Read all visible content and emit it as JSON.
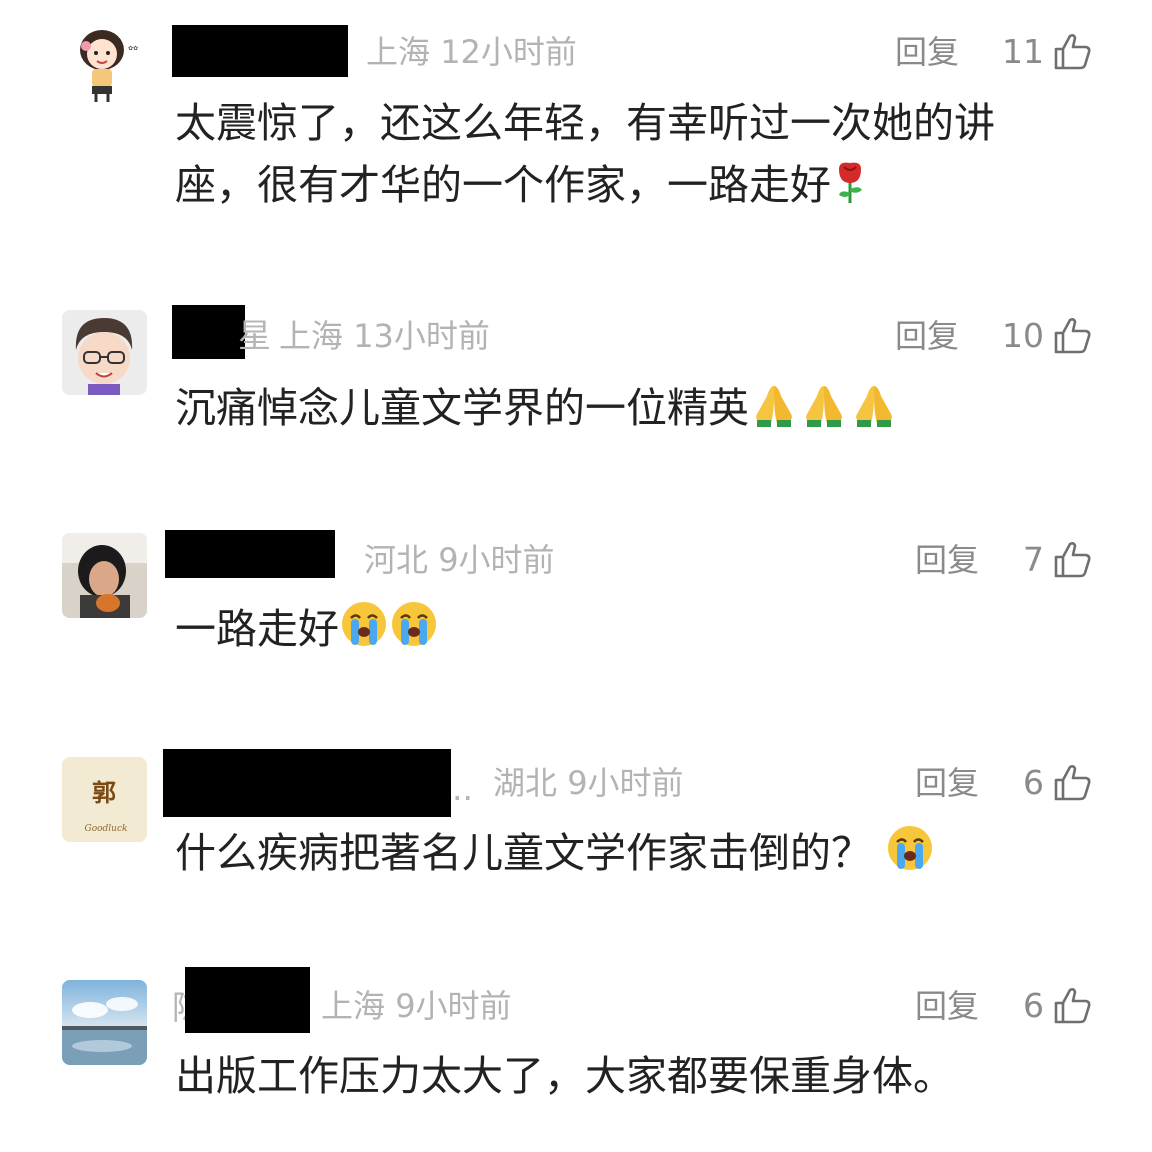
{
  "comments": [
    {
      "name_suffix": "",
      "location": "上海",
      "time": "12小时前",
      "reply_label": "回复",
      "likes": "11",
      "text": "太震惊了，还这么年轻，有幸听过一次她的讲座，很有才华的一个作家，一路走好",
      "emoji": [
        "rose-icon"
      ],
      "avatar": "cartoon-girl"
    },
    {
      "name_suffix": "星",
      "location": "上海",
      "time": "13小时前",
      "reply_label": "回复",
      "likes": "10",
      "text": "沉痛悼念儿童文学界的一位精英",
      "emoji": [
        "pray-icon",
        "pray-icon",
        "pray-icon"
      ],
      "avatar": "cartoon-boy-glasses"
    },
    {
      "name_suffix": "",
      "location": "河北",
      "time": "9小时前",
      "reply_label": "回复",
      "likes": "7",
      "text": "一路走好",
      "emoji": [
        "crying-face-icon",
        "crying-face-icon"
      ],
      "avatar": "photo-person"
    },
    {
      "name_suffix": "..",
      "location": "湖北",
      "time": "9小时前",
      "reply_label": "回复",
      "likes": "6",
      "text": "什么疾病把著名儿童文学作家击倒的？",
      "emoji": [
        "crying-face-icon"
      ],
      "avatar": "guo-character",
      "avatar_char": "郭",
      "avatar_sub": "Goodluck"
    },
    {
      "name_suffix": "陈",
      "location": "上海",
      "time": "9小时前",
      "reply_label": "回复",
      "likes": "6",
      "text": "出版工作压力太大了，大家都要保重身体。",
      "emoji": [],
      "avatar": "landscape-photo"
    }
  ],
  "colors": {
    "meta_gray": "#b3b3b3",
    "action_gray": "#8a8a8a",
    "text": "#222222"
  }
}
